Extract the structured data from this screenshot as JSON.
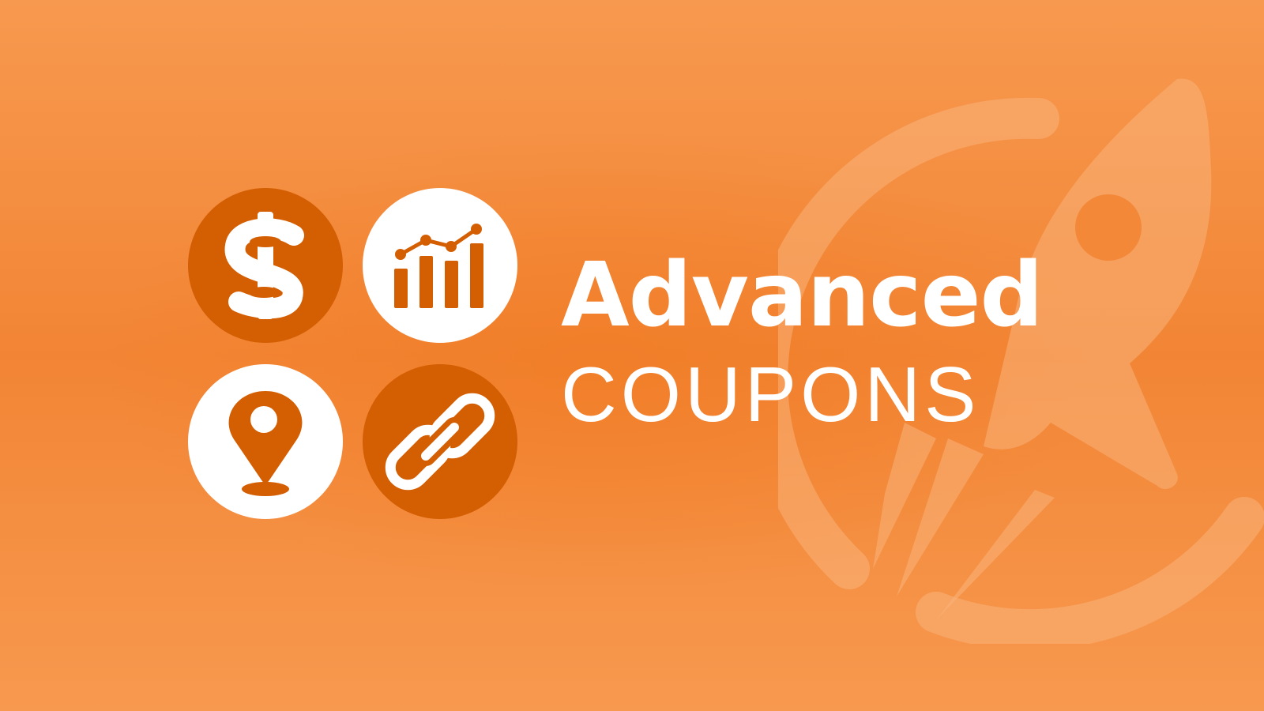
{
  "brand": {
    "title_line1": "Advanced",
    "title_line2": "COUPONS"
  },
  "icons": [
    {
      "name": "dollar-icon",
      "style": "filled-dark"
    },
    {
      "name": "chart-icon",
      "style": "filled-white"
    },
    {
      "name": "location-pin-icon",
      "style": "filled-white"
    },
    {
      "name": "link-icon",
      "style": "filled-dark"
    }
  ],
  "background": {
    "graphic": "rocket-logo-watermark"
  },
  "colors": {
    "background": "#f28535",
    "background_light": "#f7994f",
    "icon_dark": "#d45e02",
    "icon_light": "#ffffff",
    "text": "#ffffff",
    "watermark": "#f9b27a"
  }
}
